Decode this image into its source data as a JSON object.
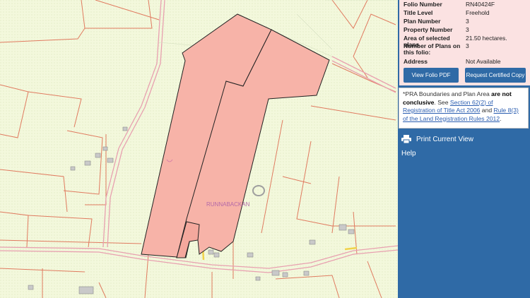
{
  "map": {
    "townland_label": "RUNNABACKAN",
    "colors": {
      "background": "#f3f8dc",
      "boundary": "#e07a5f",
      "road": "#e8a0b0",
      "parcel_fill": "#f7b3a8",
      "parcel_stroke": "#222222"
    }
  },
  "folio": {
    "rows": [
      {
        "label": "Folio Number",
        "value": "RN40424F"
      },
      {
        "label": "Title Level",
        "value": "Freehold"
      },
      {
        "label": "Plan Number",
        "value": "3"
      },
      {
        "label": "Property Number",
        "value": "3"
      },
      {
        "label": "Area of selected plans",
        "value": "21.50 hectares."
      },
      {
        "label": "Number of Plans on this folio:",
        "value": "3"
      },
      {
        "label": "Address",
        "value": "Not Available"
      }
    ],
    "view_pdf_label": "View Folio PDF",
    "request_copy_label": "Request Certified Copy"
  },
  "note": {
    "prefix": "*PRA Boundaries and Plan Area ",
    "bold": "are not conclusive",
    "see": ". See ",
    "link1": "Section 62(2) of Registration of Title Act 2006",
    "and": " and ",
    "link2": "Rule 8(3) of the Land Registration Rules 2012",
    "end": "."
  },
  "menu": {
    "print_label": "Print Current View",
    "help_label": "Help"
  },
  "colors": {
    "panel": "#2f6aa6",
    "folio_bg": "#fbe2e2",
    "link": "#2a5db0"
  }
}
